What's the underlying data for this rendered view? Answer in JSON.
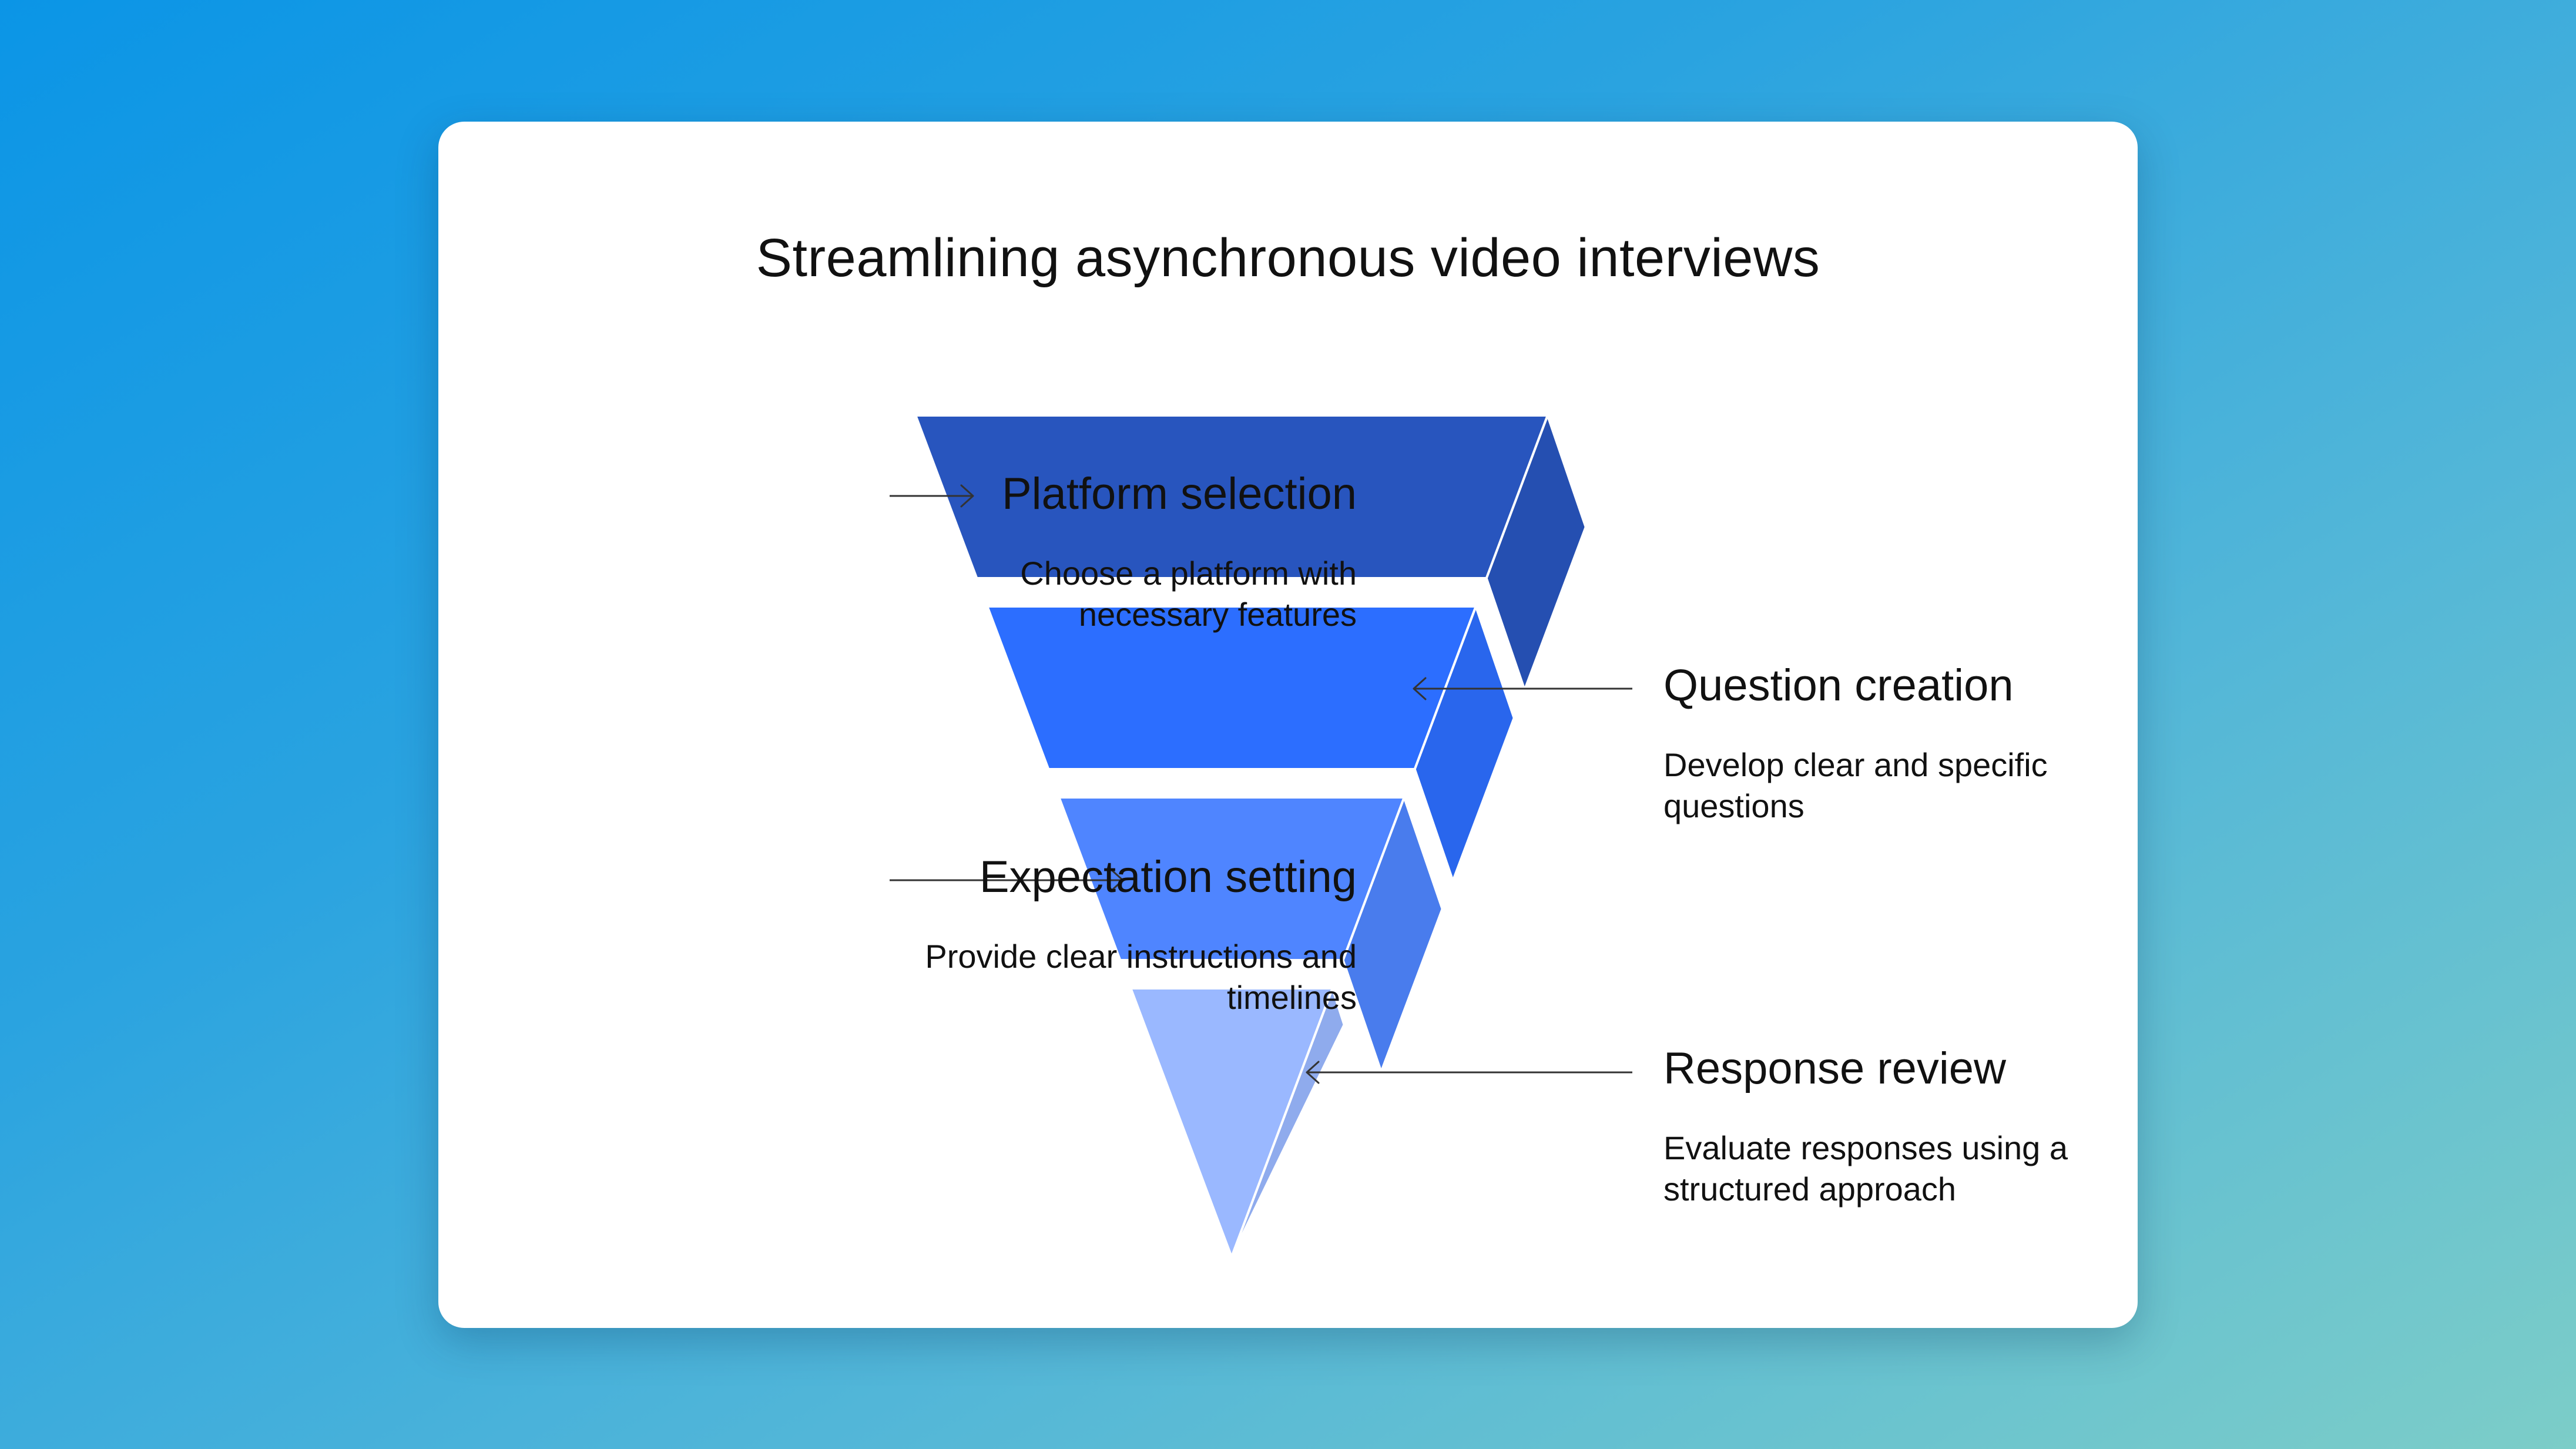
{
  "title": "Streamlining asynchronous video interviews",
  "stages": [
    {
      "heading": "Platform selection",
      "description": "Choose a platform with necessary features",
      "color": "#2855be"
    },
    {
      "heading": "Question creation",
      "description": "Develop clear and specific questions",
      "color": "#2c6eff"
    },
    {
      "heading": "Expectation setting",
      "description": "Provide clear instructions and timelines",
      "color": "#4f85ff"
    },
    {
      "heading": "Response review",
      "description": "Evaluate responses using a structured approach",
      "color": "#9ab8ff"
    }
  ],
  "colors": {
    "card": "#ffffff",
    "text": "#111111",
    "connector": "#333333"
  }
}
